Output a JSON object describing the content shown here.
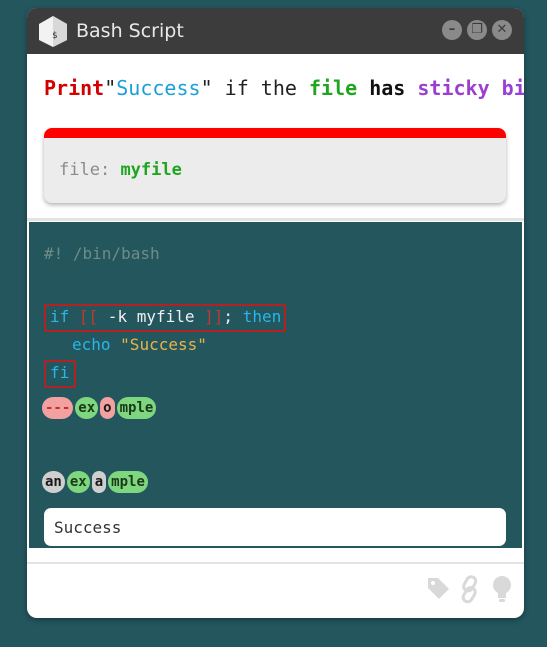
{
  "window": {
    "title": "Bash Script",
    "controls": [
      "minimize",
      "restore",
      "close"
    ]
  },
  "prompt": {
    "words": [
      {
        "text": "Print",
        "style": "red"
      },
      {
        "text": "\"",
        "style": "plain"
      },
      {
        "text": "Success",
        "style": "blue"
      },
      {
        "text": "\" ",
        "style": "plain"
      },
      {
        "text": "if",
        "style": "plain"
      },
      {
        "text": " the ",
        "style": "plain"
      },
      {
        "text": "file",
        "style": "green"
      },
      {
        "text": " ",
        "style": "plain"
      },
      {
        "text": "has",
        "style": "black"
      },
      {
        "text": " ",
        "style": "plain"
      },
      {
        "text": "sticky",
        "style": "purple"
      },
      {
        "text": " ",
        "style": "plain"
      },
      {
        "text": "bit",
        "style": "purple"
      }
    ]
  },
  "card": {
    "label": "file:",
    "value": "myfile",
    "accent_color": "#ff0000"
  },
  "code": {
    "shebang": "#! /bin/bash",
    "if_kw": "if",
    "open_bracket": "[[",
    "test": " -k myfile ",
    "close_bracket": "]]",
    "semicolon": ";",
    "then_kw": "then",
    "echo_kw": "echo",
    "echo_str": "\"Success\"",
    "fi_kw": "fi"
  },
  "tokens_row1": [
    {
      "text": "---",
      "style": "red"
    },
    {
      "text": "ex",
      "style": "green"
    },
    {
      "text": "o",
      "style": "pink"
    },
    {
      "text": "mple",
      "style": "green"
    }
  ],
  "tokens_row2": [
    {
      "text": "an",
      "style": "gray"
    },
    {
      "text": "ex",
      "style": "green"
    },
    {
      "text": "a",
      "style": "gray"
    },
    {
      "text": "mple",
      "style": "green"
    }
  ],
  "output": {
    "text": "Success"
  },
  "footer_icons": [
    "tag-icon",
    "link-icon",
    "lightbulb-icon"
  ],
  "colors": {
    "background": "#24565e",
    "titlebar": "#3c3c3c",
    "keyword_blue": "#29b6ea",
    "string": "#e8b44a",
    "error_red": "#b22222"
  }
}
